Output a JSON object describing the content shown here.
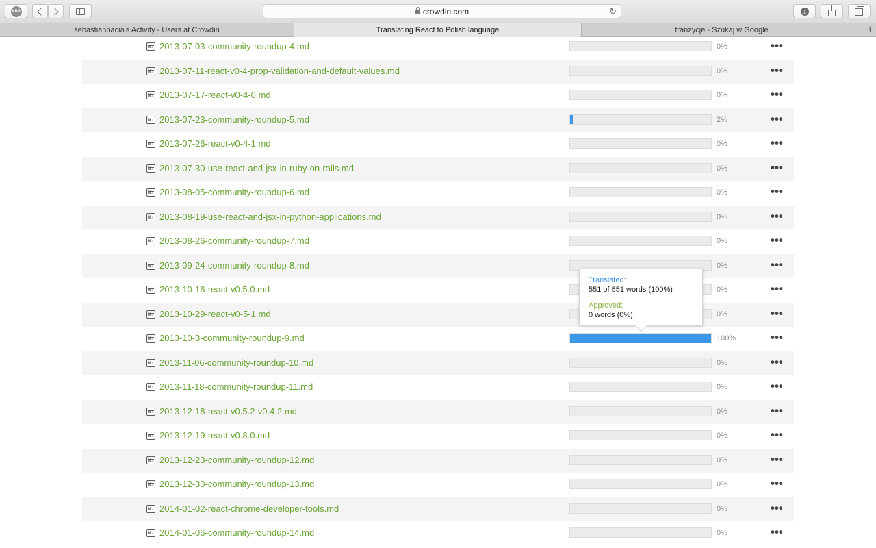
{
  "browser": {
    "url": "crowdin.com",
    "tabs": [
      {
        "title": "sebastianbacia's Activity - Users at Crowdin",
        "active": false
      },
      {
        "title": "Translating React to Polish language",
        "active": true
      },
      {
        "title": "tranzycje - Szukaj w Google",
        "active": false
      }
    ],
    "adblock_label": "ABP",
    "icons": [
      "adblock-icon",
      "back-icon",
      "forward-icon",
      "sidebar-icon",
      "lock-icon",
      "reload-icon",
      "download-icon",
      "share-icon",
      "tabs-icon",
      "new-tab-icon"
    ]
  },
  "colors": {
    "link": "#6aa534",
    "progress": "#3d97e8",
    "translated_label": "#3d97e8",
    "approved_label": "#8ab646"
  },
  "files": [
    {
      "name": "2013-07-03-community-roundup-4.md",
      "progress": 0,
      "percent": "0%"
    },
    {
      "name": "2013-07-11-react-v0-4-prop-validation-and-default-values.md",
      "progress": 0,
      "percent": "0%"
    },
    {
      "name": "2013-07-17-react-v0-4-0.md",
      "progress": 0,
      "percent": "0%"
    },
    {
      "name": "2013-07-23-community-roundup-5.md",
      "progress": 2,
      "percent": "2%"
    },
    {
      "name": "2013-07-26-react-v0-4-1.md",
      "progress": 0,
      "percent": "0%"
    },
    {
      "name": "2013-07-30-use-react-and-jsx-in-ruby-on-rails.md",
      "progress": 0,
      "percent": "0%"
    },
    {
      "name": "2013-08-05-community-roundup-6.md",
      "progress": 0,
      "percent": "0%"
    },
    {
      "name": "2013-08-19-use-react-and-jsx-in-python-applications.md",
      "progress": 0,
      "percent": "0%"
    },
    {
      "name": "2013-08-26-community-roundup-7.md",
      "progress": 0,
      "percent": "0%"
    },
    {
      "name": "2013-09-24-community-roundup-8.md",
      "progress": 0,
      "percent": "0%"
    },
    {
      "name": "2013-10-16-react-v0.5.0.md",
      "progress": 0,
      "percent": "0%"
    },
    {
      "name": "2013-10-29-react-v0-5-1.md",
      "progress": 0,
      "percent": "0%"
    },
    {
      "name": "2013-10-3-community-roundup-9.md",
      "progress": 100,
      "percent": "100%"
    },
    {
      "name": "2013-11-06-community-roundup-10.md",
      "progress": 0,
      "percent": "0%"
    },
    {
      "name": "2013-11-18-community-roundup-11.md",
      "progress": 0,
      "percent": "0%"
    },
    {
      "name": "2013-12-18-react-v0.5.2-v0.4.2.md",
      "progress": 0,
      "percent": "0%"
    },
    {
      "name": "2013-12-19-react-v0.8.0.md",
      "progress": 0,
      "percent": "0%"
    },
    {
      "name": "2013-12-23-community-roundup-12.md",
      "progress": 0,
      "percent": "0%"
    },
    {
      "name": "2013-12-30-community-roundup-13.md",
      "progress": 0,
      "percent": "0%"
    },
    {
      "name": "2014-01-02-react-chrome-developer-tools.md",
      "progress": 0,
      "percent": "0%"
    },
    {
      "name": "2014-01-06-community-roundup-14.md",
      "progress": 0,
      "percent": "0%"
    }
  ],
  "more_label": "•••",
  "tooltip": {
    "translated_label": "Translated:",
    "translated_value": "551 of 551 words (100%)",
    "approved_label": "Approved:",
    "approved_value": "0 words (0%)"
  }
}
